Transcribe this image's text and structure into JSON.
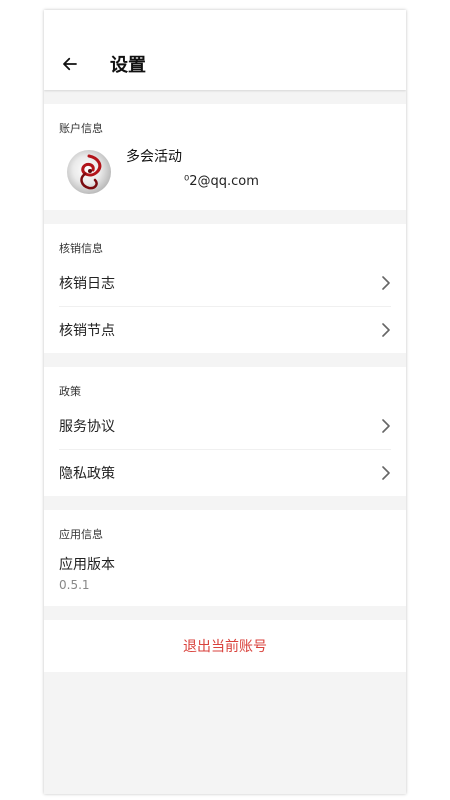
{
  "header": {
    "back_icon": "arrow-left-icon",
    "title": "设置"
  },
  "account": {
    "section_title": "账户信息",
    "avatar_icon": "dragon-logo-avatar",
    "name": "多会活动",
    "email": "⁰2@qq.com"
  },
  "verification": {
    "section_title": "核销信息",
    "items": [
      {
        "label": "核销日志",
        "icon": "chevron-right-icon"
      },
      {
        "label": "核销节点",
        "icon": "chevron-right-icon"
      }
    ]
  },
  "policy": {
    "section_title": "政策",
    "items": [
      {
        "label": "服务协议",
        "icon": "chevron-right-icon"
      },
      {
        "label": "隐私政策",
        "icon": "chevron-right-icon"
      }
    ]
  },
  "app_info": {
    "section_title": "应用信息",
    "version_label": "应用版本",
    "version_value": "0.5.1"
  },
  "logout": {
    "label": "退出当前账号",
    "color": "#d9423c"
  }
}
